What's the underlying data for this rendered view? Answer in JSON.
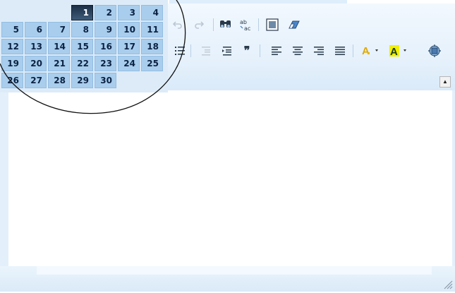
{
  "calendar": {
    "cells": [
      "",
      "",
      "",
      "1",
      "2",
      "3",
      "4",
      "5",
      "6",
      "7",
      "8",
      "9",
      "10",
      "11",
      "12",
      "13",
      "14",
      "15",
      "16",
      "17",
      "18",
      "19",
      "20",
      "21",
      "22",
      "23",
      "24",
      "25",
      "26",
      "27",
      "28",
      "29",
      "30",
      "",
      ""
    ],
    "selected": "1"
  },
  "toolbar": {
    "row1": [
      {
        "name": "undo-icon",
        "glyph": "↶",
        "enabled": false
      },
      {
        "name": "redo-icon",
        "glyph": "↷",
        "enabled": false
      },
      {
        "name": "find-icon",
        "glyph": "🔍",
        "enabled": true
      },
      {
        "name": "replace-icon",
        "glyph": "ab",
        "enabled": true
      },
      {
        "name": "select-all-icon",
        "glyph": "▣",
        "enabled": true
      },
      {
        "name": "eraser-icon",
        "glyph": "⌫",
        "enabled": true
      }
    ],
    "row2": [
      {
        "name": "bullet-list-icon",
        "glyph": "☰",
        "enabled": true
      },
      {
        "name": "outdent-icon",
        "glyph": "⇤",
        "enabled": false
      },
      {
        "name": "indent-icon",
        "glyph": "⇥",
        "enabled": true
      },
      {
        "name": "blockquote-icon",
        "glyph": "❞",
        "enabled": true
      },
      {
        "name": "align-left-icon",
        "glyph": "≡",
        "enabled": true
      },
      {
        "name": "align-center-icon",
        "glyph": "≡",
        "enabled": true
      },
      {
        "name": "align-right-icon",
        "glyph": "≡",
        "enabled": true
      },
      {
        "name": "justify-icon",
        "glyph": "≡",
        "enabled": true
      },
      {
        "name": "font-color-icon",
        "glyph": "A",
        "enabled": true
      },
      {
        "name": "highlight-color-icon",
        "glyph": "A",
        "enabled": true
      },
      {
        "name": "fullscreen-icon",
        "glyph": "◈",
        "enabled": true
      }
    ]
  },
  "colors": {
    "calendar_cell": "#a9cdec",
    "calendar_selected": "#1c2f46",
    "toolbar_bg": "#e4f0fb",
    "font_color_swatch": "#f2c200",
    "highlight_swatch": "#f5f000"
  }
}
